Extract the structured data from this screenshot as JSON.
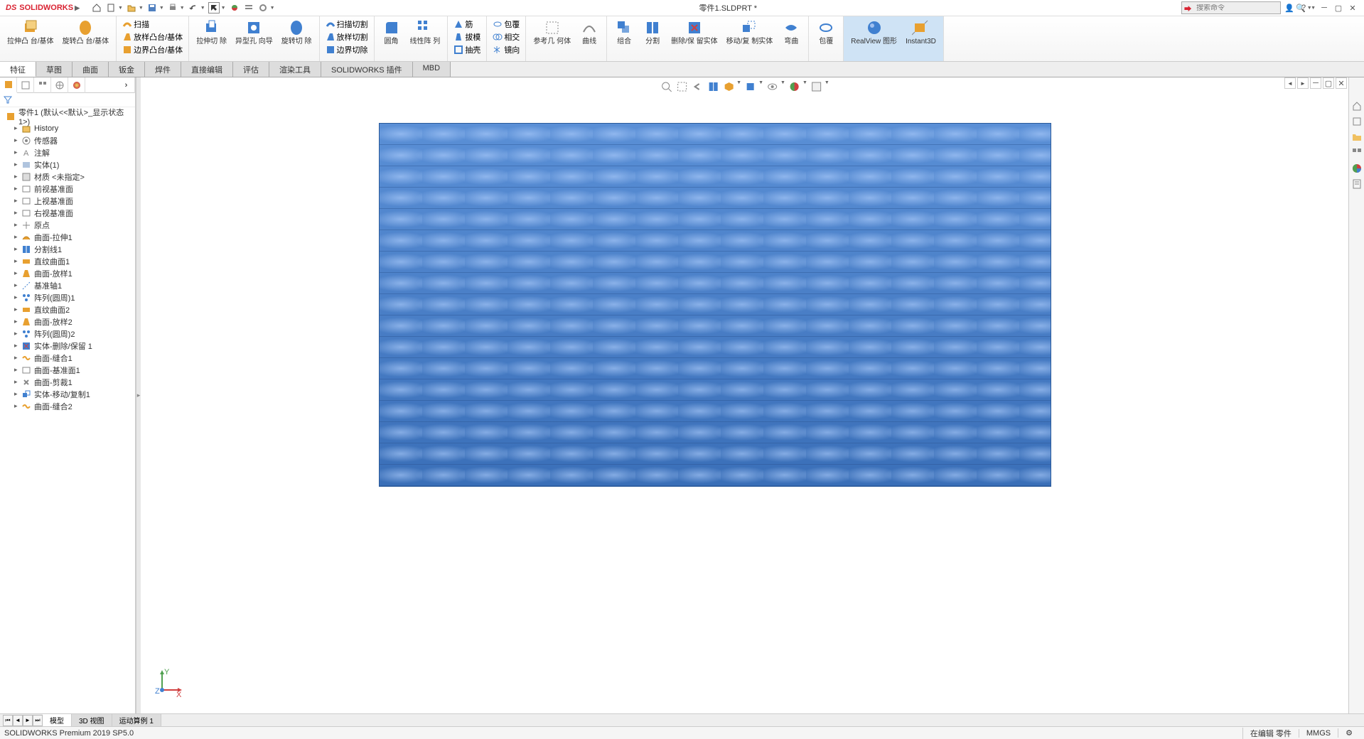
{
  "app": {
    "logo_text": "SOLIDWORKS",
    "title": "零件1.SLDPRT *",
    "search_placeholder": "搜索命令"
  },
  "ribbon": {
    "groups": [
      {
        "id": "extrude",
        "label": "拉伸凸\n台/基体"
      },
      {
        "id": "revolve",
        "label": "旋转凸\n台/基体"
      },
      {
        "id": "sweep",
        "label": "扫描"
      },
      {
        "id": "loft",
        "label": "放样凸台/基体"
      },
      {
        "id": "boundary",
        "label": "边界凸台/基体"
      },
      {
        "id": "cut-extrude",
        "label": "拉伸切\n除"
      },
      {
        "id": "wizard",
        "label": "异型孔\n向导"
      },
      {
        "id": "cut-revolve",
        "label": "旋转切\n除"
      },
      {
        "id": "cut-sweep",
        "label": "扫描切割"
      },
      {
        "id": "cut-loft",
        "label": "放样切割"
      },
      {
        "id": "cut-boundary",
        "label": "边界切除"
      },
      {
        "id": "fillet",
        "label": "圆角"
      },
      {
        "id": "pattern",
        "label": "线性阵\n列"
      },
      {
        "id": "rib",
        "label": "筋"
      },
      {
        "id": "draft",
        "label": "拔模"
      },
      {
        "id": "shell",
        "label": "抽壳"
      },
      {
        "id": "wrap",
        "label": "包覆"
      },
      {
        "id": "intersect",
        "label": "相交"
      },
      {
        "id": "mirror",
        "label": "镜向"
      },
      {
        "id": "refgeom",
        "label": "参考几\n何体"
      },
      {
        "id": "curves",
        "label": "曲线"
      },
      {
        "id": "combine",
        "label": "组合"
      },
      {
        "id": "split",
        "label": "分割"
      },
      {
        "id": "delete",
        "label": "删除/保\n留实体"
      },
      {
        "id": "move",
        "label": "移动/复\n制实体"
      },
      {
        "id": "bend",
        "label": "弯曲"
      },
      {
        "id": "wrap2",
        "label": "包覆"
      },
      {
        "id": "realview",
        "label": "RealView\n图形"
      },
      {
        "id": "instant3d",
        "label": "Instant3D"
      }
    ]
  },
  "tabs": {
    "items": [
      "特征",
      "草图",
      "曲面",
      "钣金",
      "焊件",
      "直接编辑",
      "评估",
      "渲染工具",
      "SOLIDWORKS 插件",
      "MBD"
    ],
    "active": 0
  },
  "tree": {
    "root": "零件1  (默认<<默认>_显示状态 1>)",
    "nodes": [
      {
        "icon": "folder",
        "label": "History"
      },
      {
        "icon": "sensor",
        "label": "传感器"
      },
      {
        "icon": "annotation",
        "label": "注解"
      },
      {
        "icon": "solid",
        "label": "实体(1)"
      },
      {
        "icon": "material",
        "label": "材质 <未指定>"
      },
      {
        "icon": "plane",
        "label": "前视基准面"
      },
      {
        "icon": "plane",
        "label": "上视基准面"
      },
      {
        "icon": "plane",
        "label": "右视基准面"
      },
      {
        "icon": "origin",
        "label": "原点"
      },
      {
        "icon": "surface",
        "label": "曲面-拉伸1"
      },
      {
        "icon": "split",
        "label": "分割线1"
      },
      {
        "icon": "ruled",
        "label": "直纹曲面1"
      },
      {
        "icon": "loft",
        "label": "曲面-放样1"
      },
      {
        "icon": "axis",
        "label": "基准轴1"
      },
      {
        "icon": "pattern",
        "label": "阵列(圆周)1"
      },
      {
        "icon": "ruled",
        "label": "直纹曲面2"
      },
      {
        "icon": "loft",
        "label": "曲面-放样2"
      },
      {
        "icon": "pattern",
        "label": "阵列(圆周)2"
      },
      {
        "icon": "delete",
        "label": "实体-删除/保留 1"
      },
      {
        "icon": "knit",
        "label": "曲面-缝合1"
      },
      {
        "icon": "plane",
        "label": "曲面-基准面1"
      },
      {
        "icon": "trim",
        "label": "曲面-剪裁1"
      },
      {
        "icon": "move",
        "label": "实体-移动/复制1"
      },
      {
        "icon": "knit",
        "label": "曲面-缝合2"
      }
    ]
  },
  "bottom_tabs": {
    "items": [
      "模型",
      "3D 视图",
      "运动算例 1"
    ],
    "active": 0
  },
  "status": {
    "product": "SOLIDWORKS Premium 2019 SP5.0",
    "state": "在编辑 零件",
    "units": "MMGS"
  },
  "triad": {
    "x": "X",
    "y": "Y",
    "z": "Z"
  }
}
